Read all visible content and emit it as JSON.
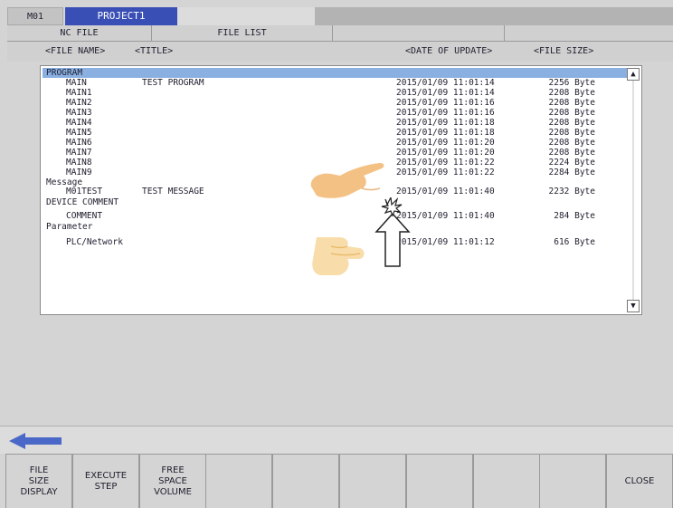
{
  "header": {
    "tab_m01": "M01",
    "tab_project": "PROJECT1"
  },
  "title_row": {
    "left": "NC FILE",
    "center": "FILE LIST"
  },
  "columns": {
    "file_name": "<FILE NAME>",
    "title": "<TITLE>",
    "date": "<DATE OF UPDATE>",
    "size": "<FILE SIZE>"
  },
  "files": [
    {
      "name": "PROGRAM",
      "title": "",
      "date": "",
      "size": "",
      "kind": "group"
    },
    {
      "name": "MAIN",
      "title": "TEST PROGRAM",
      "date": "2015/01/09 11:01:14",
      "size": "2256 Byte",
      "kind": "file"
    },
    {
      "name": "MAIN1",
      "title": "",
      "date": "2015/01/09 11:01:14",
      "size": "2208 Byte",
      "kind": "file"
    },
    {
      "name": "MAIN2",
      "title": "",
      "date": "2015/01/09 11:01:16",
      "size": "2208 Byte",
      "kind": "file"
    },
    {
      "name": "MAIN3",
      "title": "",
      "date": "2015/01/09 11:01:16",
      "size": "2208 Byte",
      "kind": "file"
    },
    {
      "name": "MAIN4",
      "title": "",
      "date": "2015/01/09 11:01:18",
      "size": "2208 Byte",
      "kind": "file"
    },
    {
      "name": "MAIN5",
      "title": "",
      "date": "2015/01/09 11:01:18",
      "size": "2208 Byte",
      "kind": "file"
    },
    {
      "name": "MAIN6",
      "title": "",
      "date": "2015/01/09 11:01:20",
      "size": "2208 Byte",
      "kind": "file"
    },
    {
      "name": "MAIN7",
      "title": "",
      "date": "2015/01/09 11:01:20",
      "size": "2208 Byte",
      "kind": "file"
    },
    {
      "name": "MAIN8",
      "title": "",
      "date": "2015/01/09 11:01:22",
      "size": "2224 Byte",
      "kind": "file"
    },
    {
      "name": "MAIN9",
      "title": "",
      "date": "2015/01/09 11:01:22",
      "size": "2284 Byte",
      "kind": "file"
    },
    {
      "name": "Message",
      "title": "",
      "date": "",
      "size": "",
      "kind": "group"
    },
    {
      "name": "M01TEST",
      "title": "TEST MESSAGE",
      "date": "2015/01/09 11:01:40",
      "size": "2232 Byte",
      "kind": "file"
    },
    {
      "name": "DEVICE COMMENT",
      "title": "",
      "date": "",
      "size": "",
      "kind": "group"
    },
    {
      "name": "COMMENT",
      "title": "",
      "date": "2015/01/09 11:01:40",
      "size": "284 Byte",
      "kind": "file"
    },
    {
      "name": "Parameter",
      "title": "",
      "date": "",
      "size": "",
      "kind": "group"
    },
    {
      "name": "PLC/Network",
      "title": "",
      "date": "2015/01/09 11:01:12",
      "size": "616 Byte",
      "kind": "file"
    }
  ],
  "function_keys": [
    "FILE\nSIZE\nDISPLAY",
    "EXECUTE\nSTEP",
    "FREE\nSPACE\nVOLUME",
    "",
    "",
    "",
    "",
    "",
    "",
    "CLOSE"
  ],
  "icons": {
    "scroll_up": "▲",
    "scroll_down": "▼",
    "back": "back-arrow-icon",
    "hand": "pointing-hand-icon",
    "tap": "tap-arrow-icon"
  },
  "colors": {
    "accent": "#3a4fb5",
    "selection": "#8ab0e2",
    "background": "#d4d4d4"
  }
}
